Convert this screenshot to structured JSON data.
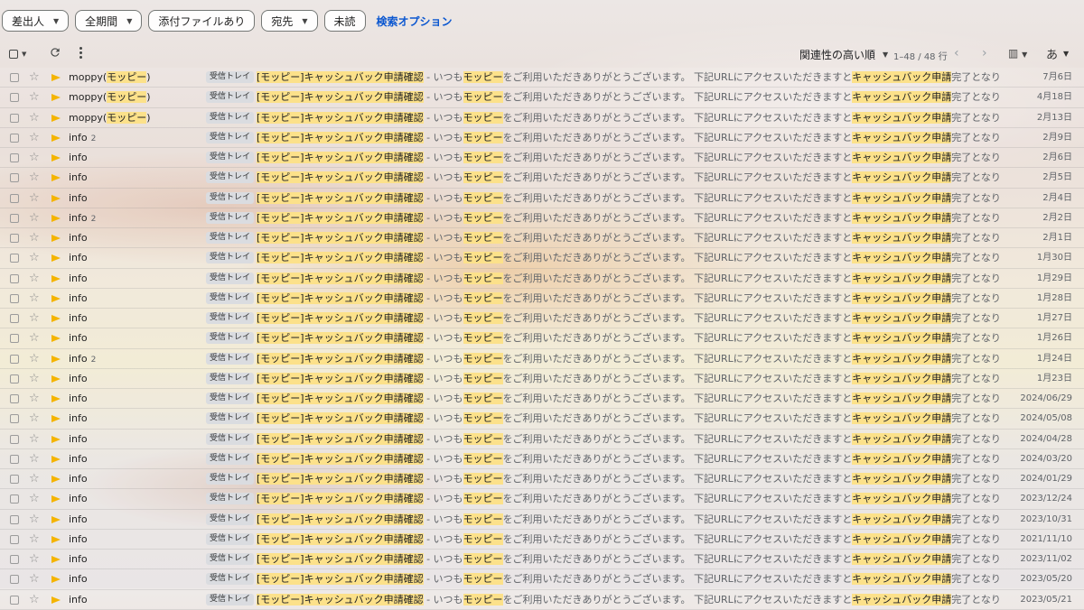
{
  "filters": {
    "chips": [
      {
        "label": "差出人",
        "has_caret": true
      },
      {
        "label": "全期間",
        "has_caret": true
      },
      {
        "label": "添付ファイルあり",
        "has_caret": false
      },
      {
        "label": "宛先",
        "has_caret": true
      },
      {
        "label": "未読",
        "has_caret": false
      }
    ],
    "search_options": "検索オプション"
  },
  "toolbar": {
    "sort_label": "関連性の高い順",
    "range_label": "1–48 / 48 行",
    "lang_label": "あ",
    "icons": [
      "select-all-icon",
      "refresh-icon",
      "more-vert-icon",
      "chevron-left-icon",
      "chevron-right-icon",
      "density-icon"
    ]
  },
  "colors": {
    "highlight": "#fce18a",
    "important_marker": "#f4b400",
    "link": "#0b57d0"
  },
  "email_common": {
    "label": "受信トレイ",
    "subject_bracket_open": "[",
    "subject_hl1": "モッピー",
    "subject_bracket_close": "]",
    "subject_hl2": "キャッシュバック申請確認",
    "sep": " - いつも",
    "snip_hl1": "モッピー",
    "snip_mid": "をご利用いただきありがとうございます。 下記URLにアクセスいただきますと",
    "snip_hl2": "キャッシュバック申請",
    "snip_end": "完了となります..."
  },
  "emails": [
    {
      "sender": "moppy(",
      "sender_hl": "モッピー",
      "sender_end": ")",
      "count": "",
      "date": "7月6日"
    },
    {
      "sender": "moppy(",
      "sender_hl": "モッピー",
      "sender_end": ")",
      "count": "",
      "date": "4月18日"
    },
    {
      "sender": "moppy(",
      "sender_hl": "モッピー",
      "sender_end": ")",
      "count": "",
      "date": "2月13日"
    },
    {
      "sender": "info",
      "sender_hl": "",
      "sender_end": "",
      "count": "2",
      "date": "2月9日"
    },
    {
      "sender": "info",
      "sender_hl": "",
      "sender_end": "",
      "count": "",
      "date": "2月6日"
    },
    {
      "sender": "info",
      "sender_hl": "",
      "sender_end": "",
      "count": "",
      "date": "2月5日"
    },
    {
      "sender": "info",
      "sender_hl": "",
      "sender_end": "",
      "count": "",
      "date": "2月4日"
    },
    {
      "sender": "info",
      "sender_hl": "",
      "sender_end": "",
      "count": "2",
      "date": "2月2日"
    },
    {
      "sender": "info",
      "sender_hl": "",
      "sender_end": "",
      "count": "",
      "date": "2月1日"
    },
    {
      "sender": "info",
      "sender_hl": "",
      "sender_end": "",
      "count": "",
      "date": "1月30日"
    },
    {
      "sender": "info",
      "sender_hl": "",
      "sender_end": "",
      "count": "",
      "date": "1月29日"
    },
    {
      "sender": "info",
      "sender_hl": "",
      "sender_end": "",
      "count": "",
      "date": "1月28日"
    },
    {
      "sender": "info",
      "sender_hl": "",
      "sender_end": "",
      "count": "",
      "date": "1月27日"
    },
    {
      "sender": "info",
      "sender_hl": "",
      "sender_end": "",
      "count": "",
      "date": "1月26日"
    },
    {
      "sender": "info",
      "sender_hl": "",
      "sender_end": "",
      "count": "2",
      "date": "1月24日"
    },
    {
      "sender": "info",
      "sender_hl": "",
      "sender_end": "",
      "count": "",
      "date": "1月23日"
    },
    {
      "sender": "info",
      "sender_hl": "",
      "sender_end": "",
      "count": "",
      "date": "2024/06/29"
    },
    {
      "sender": "info",
      "sender_hl": "",
      "sender_end": "",
      "count": "",
      "date": "2024/05/08"
    },
    {
      "sender": "info",
      "sender_hl": "",
      "sender_end": "",
      "count": "",
      "date": "2024/04/28"
    },
    {
      "sender": "info",
      "sender_hl": "",
      "sender_end": "",
      "count": "",
      "date": "2024/03/20"
    },
    {
      "sender": "info",
      "sender_hl": "",
      "sender_end": "",
      "count": "",
      "date": "2024/01/29"
    },
    {
      "sender": "info",
      "sender_hl": "",
      "sender_end": "",
      "count": "",
      "date": "2023/12/24"
    },
    {
      "sender": "info",
      "sender_hl": "",
      "sender_end": "",
      "count": "",
      "date": "2023/10/31"
    },
    {
      "sender": "info",
      "sender_hl": "",
      "sender_end": "",
      "count": "",
      "date": "2021/11/10"
    },
    {
      "sender": "info",
      "sender_hl": "",
      "sender_end": "",
      "count": "",
      "date": "2023/11/02"
    },
    {
      "sender": "info",
      "sender_hl": "",
      "sender_end": "",
      "count": "",
      "date": "2023/05/20"
    },
    {
      "sender": "info",
      "sender_hl": "",
      "sender_end": "",
      "count": "",
      "date": "2023/05/21"
    }
  ]
}
